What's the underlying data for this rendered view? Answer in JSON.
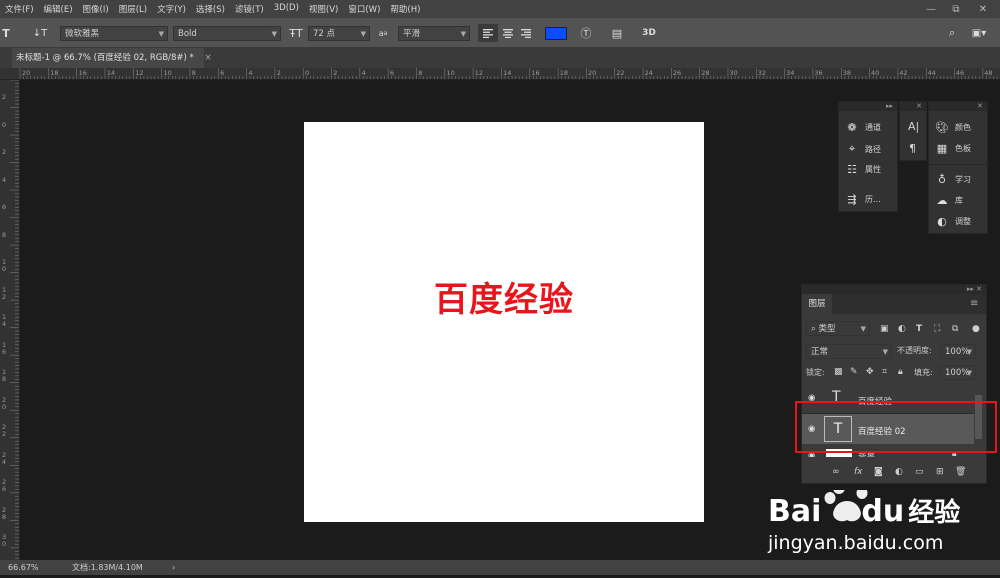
{
  "menu": [
    "文件(F)",
    "编辑(E)",
    "图像(I)",
    "图层(L)",
    "文字(Y)",
    "选择(S)",
    "滤镜(T)",
    "3D(D)",
    "视图(V)",
    "窗口(W)",
    "帮助(H)"
  ],
  "window_controls": {
    "minimize": "—",
    "restore": "⧉",
    "close": "✕"
  },
  "options": {
    "font_family": "微软雅黑",
    "font_style": "Bold",
    "font_size": "72 点",
    "aa_icon_label": "a",
    "antialias": "平滑",
    "mode_3d": "3D",
    "text_color": "#0a4dff"
  },
  "document_tab": {
    "title": "未标题-1 @ 66.7% (百度经验 02, RGB/8#) *",
    "close": "×"
  },
  "ruler_top_labels": [
    "20",
    "18",
    "16",
    "14",
    "12",
    "10",
    "8",
    "6",
    "4",
    "2",
    "0",
    "2",
    "4",
    "6",
    "8",
    "10",
    "12",
    "14",
    "16",
    "18",
    "20",
    "22",
    "24",
    "26",
    "28",
    "30",
    "32",
    "34",
    "36",
    "38",
    "40",
    "42",
    "44",
    "46",
    "48"
  ],
  "ruler_left_labels": [
    "2",
    "0",
    "2",
    "4",
    "6",
    "8",
    "1\n0",
    "1\n2",
    "1\n4",
    "1\n6",
    "1\n8",
    "2\n0",
    "2\n2",
    "2\n4",
    "2\n6",
    "2\n8",
    "3\n0"
  ],
  "canvas": {
    "text": "百度经验",
    "text_color": "#e8161c"
  },
  "panel_a": {
    "items": [
      "通道",
      "路径",
      "属性",
      "历..."
    ]
  },
  "panel_b": {
    "items": [
      "A|",
      "¶"
    ]
  },
  "panel_c": {
    "items": [
      "颜色",
      "色板",
      "学习",
      "库",
      "调整"
    ]
  },
  "layers": {
    "tab": "图层",
    "filter_kind": "类型",
    "blend_mode": "正常",
    "opacity_label": "不透明度:",
    "opacity_value": "100%",
    "lock_label": "锁定:",
    "fill_label": "填充:",
    "fill_value": "100%",
    "rows": [
      {
        "thumb": "T",
        "name": "百度经验"
      },
      {
        "thumb": "T",
        "name": "百度经验 02"
      },
      {
        "thumb": "",
        "name": "背景"
      }
    ]
  },
  "status": {
    "zoom": "66.67%",
    "doc": "文档:1.83M/4.10M",
    "arrow": "›"
  },
  "watermark": {
    "logo": "Bai",
    "logo_du": "du",
    "logo_cn": "经验",
    "url": "jingyan.baidu.com"
  }
}
